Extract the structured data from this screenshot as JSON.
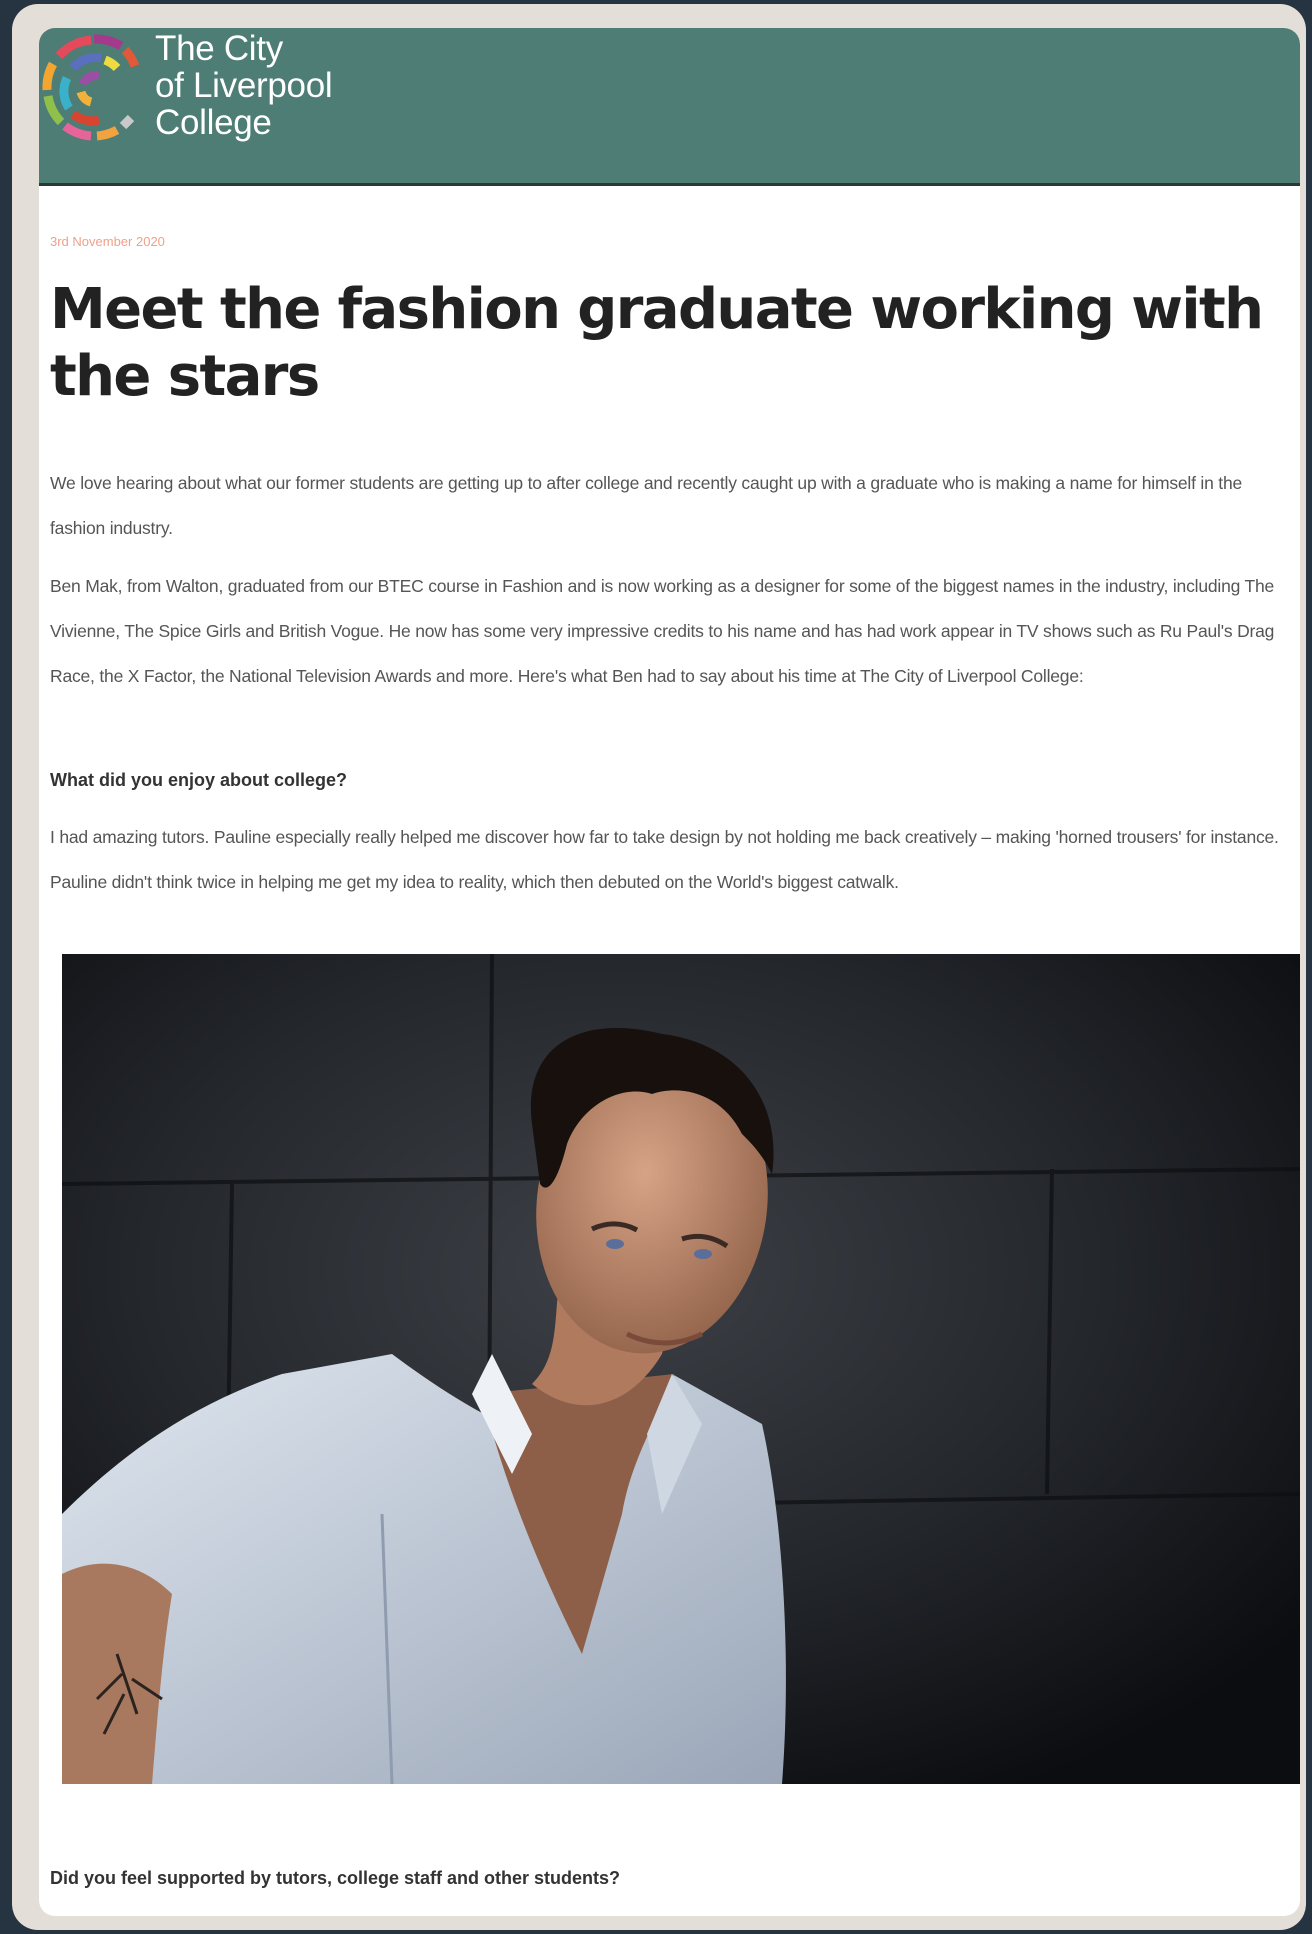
{
  "header": {
    "logo_line1": "The City",
    "logo_line2": "of Liverpool",
    "logo_line3": "College",
    "background_color": "#4d7d75"
  },
  "article": {
    "date": "3rd November 2020",
    "title": "Meet the fashion graduate working with the stars",
    "intro": "We love hearing about what our former students are getting up to after college and recently caught up with a graduate who is making a name for himself in the fashion industry.",
    "body1": "Ben Mak, from Walton, graduated from our BTEC course in Fashion and is now working as a designer for some of the biggest names in the industry, including The Vivienne, The Spice Girls and British Vogue. He now has some very impressive credits to his name and has had work appear in TV shows such as Ru Paul's Drag Race, the X Factor, the National Television Awards and more. Here's what Ben had to say about his time at The City of Liverpool College:",
    "q1": "What did you enjoy about college?",
    "a1": "I had amazing tutors. Pauline especially really helped me discover how far to take design by not holding me back creatively – making 'horned trousers' for instance. Pauline didn't think twice in helping me get my idea to reality, which then debuted on the World's biggest catwalk.",
    "q2": "Did you feel supported by tutors, college staff and other students?"
  },
  "colors": {
    "date": "#f1a08a",
    "title": "#222222",
    "body_text": "#555555"
  }
}
